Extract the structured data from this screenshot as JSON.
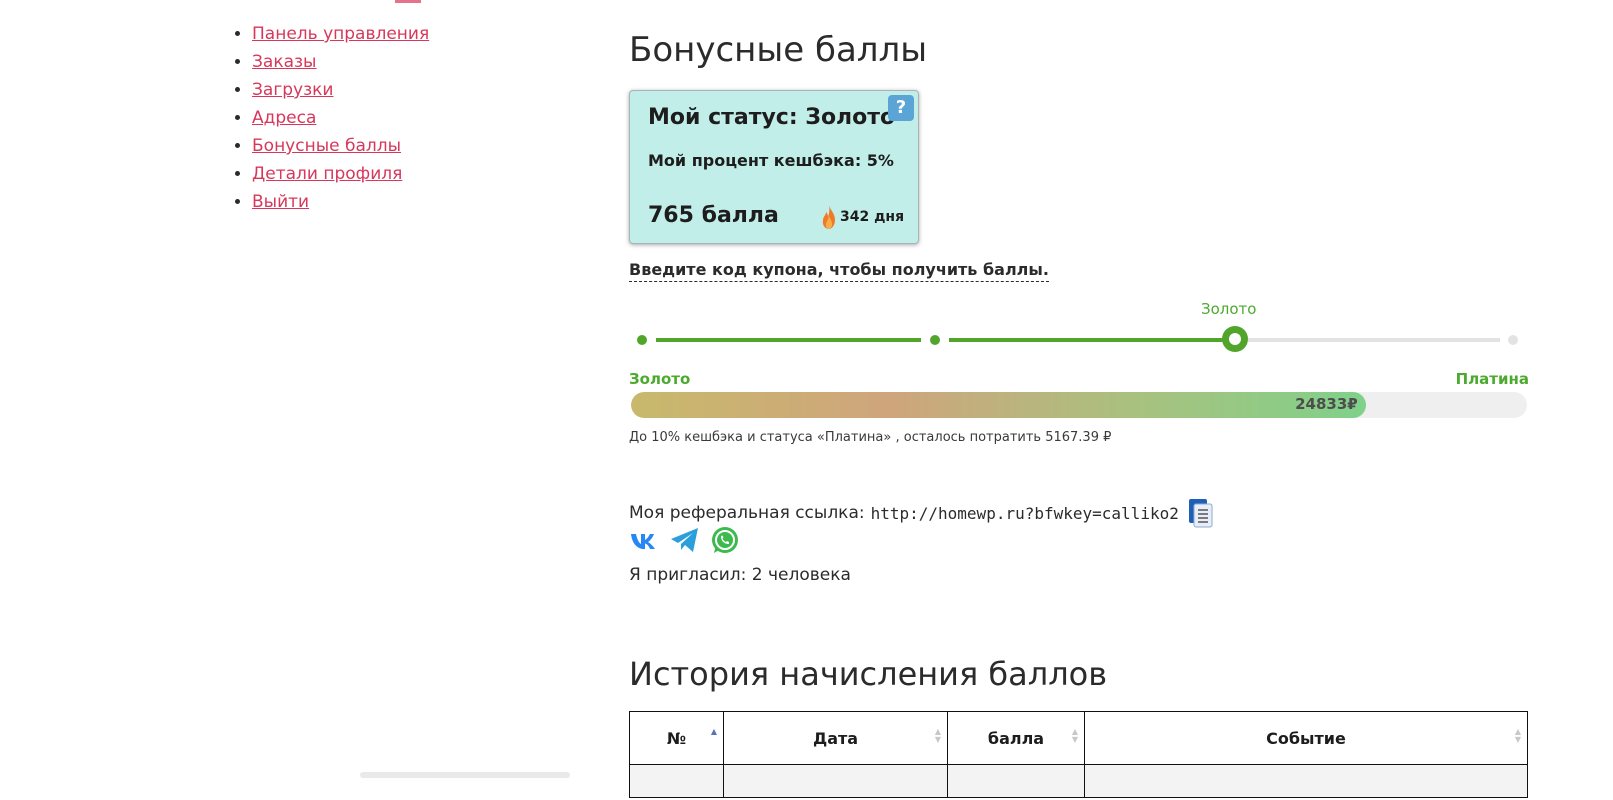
{
  "sidebar": {
    "items": [
      {
        "label": "Панель управления"
      },
      {
        "label": "Заказы"
      },
      {
        "label": "Загрузки"
      },
      {
        "label": "Адреса"
      },
      {
        "label": "Бонусные баллы"
      },
      {
        "label": "Детали профиля"
      },
      {
        "label": "Выйти"
      }
    ]
  },
  "main": {
    "title": "Бонусные баллы",
    "status_card": {
      "status": "Мой статус: Золото",
      "help": "?",
      "cashback": "Мой процент кешбэка: 5%",
      "points": "765 балла",
      "streak": "342 дня",
      "background": "#c2eeea"
    },
    "coupon_link": "Введите код купона, чтобы получить баллы.",
    "levels": {
      "current_label": "Золото",
      "current_index": 2,
      "count": 4,
      "accent": "#52a52b"
    },
    "spend_progress": {
      "from": "Золото",
      "to": "Платина",
      "amount": "24833₽",
      "fill_fraction": 0.82,
      "note": "До 10% кешбэка и статуса «Платина» , осталось потратить 5167.39 ₽"
    },
    "referral": {
      "label": "Моя реферальная ссылка:",
      "url": "http://homewp.ru?bfwkey=calliko2",
      "invited": "Я пригласил: 2 человека",
      "icons": [
        "vk-icon",
        "telegram-icon",
        "whatsapp-icon",
        "copy-icon"
      ]
    },
    "history": {
      "title": "История начисления баллов",
      "columns": [
        {
          "label": "№"
        },
        {
          "label": "Дата"
        },
        {
          "label": "балла"
        },
        {
          "label": "Событие"
        }
      ]
    }
  }
}
